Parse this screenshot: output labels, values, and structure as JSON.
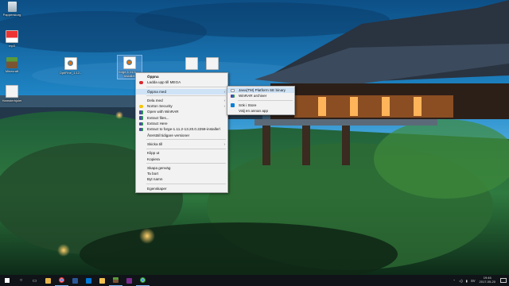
{
  "desktop": {
    "icons": [
      {
        "label": "Papperskorg",
        "icon": "recycle-bin-icon"
      },
      {
        "label": "mp3",
        "icon": "file-icon"
      },
      {
        "label": "Minecraft",
        "icon": "minecraft-icon"
      },
      {
        "label": "OptiFine_1.12...",
        "icon": "java-jar-icon"
      },
      {
        "label": "forge-1.11.2-...-installer",
        "icon": "java-jar-icon"
      },
      {
        "label": "",
        "icon": "document-icon"
      },
      {
        "label": "",
        "icon": "document-icon"
      },
      {
        "label": "Hamsterhjulet",
        "icon": "document-icon"
      }
    ]
  },
  "context_menu": {
    "items": [
      {
        "label": "Öppna",
        "bold": true
      },
      {
        "label": "Ladda upp till MEGA",
        "icon": "mega-icon"
      },
      {
        "label": "Öppna med",
        "submenu": true
      },
      {
        "label": "Dela med",
        "submenu": true
      },
      {
        "label": "Norton Security",
        "icon": "norton-icon",
        "submenu": true
      },
      {
        "label": "Open with WinRAR",
        "icon": "winrar-icon"
      },
      {
        "label": "Extract files...",
        "icon": "winrar-icon"
      },
      {
        "label": "Extract Here",
        "icon": "winrar-icon"
      },
      {
        "label": "Extract to forge-1.11.2-13.20.0.2259-installer\\",
        "icon": "winrar-icon"
      },
      {
        "label": "Återställ tidigare versioner"
      },
      {
        "label": "Skicka till",
        "submenu": true
      },
      {
        "label": "Klipp ut"
      },
      {
        "label": "Kopiera"
      },
      {
        "label": "Skapa genväg"
      },
      {
        "label": "Ta bort"
      },
      {
        "label": "Byt namn"
      },
      {
        "label": "Egenskaper"
      }
    ]
  },
  "submenu": {
    "items": [
      {
        "label": "Java(TM) Platform SE binary",
        "icon": "java-icon"
      },
      {
        "label": "WinRAR archiver",
        "icon": "winrar-icon"
      },
      {
        "label": "Sök i Store",
        "icon": "store-icon"
      },
      {
        "label": "Välj en annan app"
      }
    ]
  },
  "taskbar": {
    "apps": [
      "search-icon",
      "task-view-icon",
      "file-explorer-icon",
      "chrome-icon",
      "word-icon",
      "mail-icon",
      "explorer-icon",
      "minecraft-icon",
      "app-icon",
      "chrome-icon"
    ],
    "time": "19:46",
    "date": "2017-05-20",
    "tray_icons": [
      "chevron-up-icon",
      "volume-icon",
      "network-icon",
      "language-icon"
    ]
  }
}
